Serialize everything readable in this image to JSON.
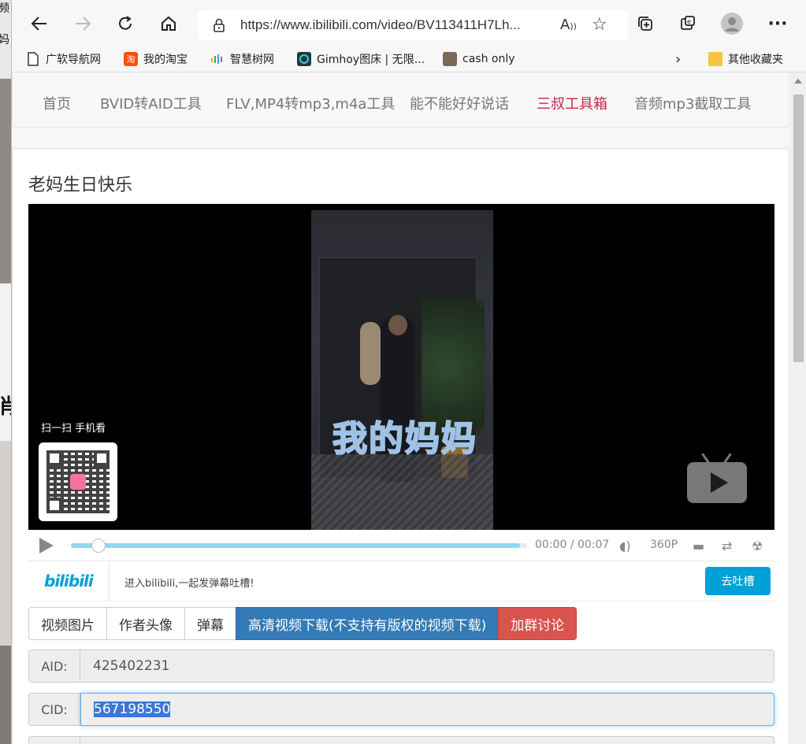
{
  "background_window": {
    "glyphs": [
      "频",
      "妈",
      "肖"
    ]
  },
  "browser": {
    "url": "https://www.ibilibili.com/video/BV113411H7Lh...",
    "bookmarks": [
      {
        "label": "广软导航网",
        "icon": "page-icon"
      },
      {
        "label": "我的淘宝",
        "icon": "taobao-icon"
      },
      {
        "label": "智慧树网",
        "icon": "zhihuishu-icon"
      },
      {
        "label": "Gimhoy图床 | 无限...",
        "icon": "gimhoy-icon"
      },
      {
        "label": "cash only",
        "icon": "avatar-icon"
      }
    ],
    "other_bookmarks": "其他收藏夹",
    "icons": {
      "back": "arrow-left-icon",
      "forward": "arrow-right-icon",
      "refresh": "refresh-icon",
      "home": "home-icon",
      "lock": "lock-icon",
      "read_aloud": "read-aloud-icon",
      "favorite": "add-favorite-icon",
      "collections": "collections-icon",
      "extensions": "extensions-icon",
      "profile": "profile-icon",
      "menu": "more-icon"
    }
  },
  "nav": {
    "items": [
      "首页",
      "BVID转AID工具",
      "FLV,MP4转mp3,m4a工具",
      "能不能好好说话",
      "三叔工具箱",
      "音频mp3截取工具"
    ],
    "active_index": 4
  },
  "video": {
    "title": "老妈生日快乐",
    "overlay_text": "我的妈妈",
    "scan_label": "扫一扫 手机看",
    "current_time": "00:00",
    "separator": "/",
    "duration": "00:07",
    "quality": "360P",
    "progress_fraction": 0.06
  },
  "danmu": {
    "logo": "bilibili",
    "hint": "进入bilibili,一起发弹幕吐槽!",
    "button": "去吐槽"
  },
  "tabs": [
    {
      "label": "视频图片",
      "style": "default"
    },
    {
      "label": "作者头像",
      "style": "default"
    },
    {
      "label": "弹幕",
      "style": "default"
    },
    {
      "label": "高清视频下载(不支持有版权的视频下载)",
      "style": "primary"
    },
    {
      "label": "加群讨论",
      "style": "danger"
    }
  ],
  "fields": [
    {
      "label": "AID:",
      "value": "425402231"
    },
    {
      "label": "CID:",
      "value": "567198550"
    }
  ],
  "colors": {
    "active_nav": "#c7254e",
    "primary": "#337ab7",
    "danger": "#d9534f",
    "bilibili_blue": "#00a1d6"
  }
}
